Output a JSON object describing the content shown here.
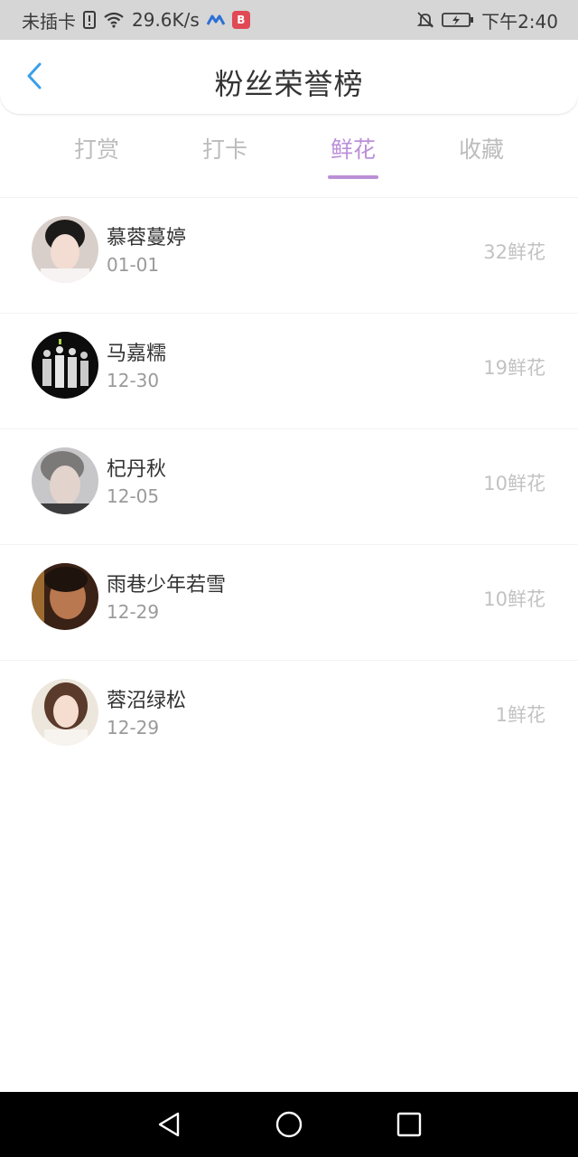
{
  "status_bar": {
    "carrier": "未插卡",
    "speed": "29.6K/s",
    "time": "下午2:40",
    "icons": [
      "sim-alert-icon",
      "wifi-icon",
      "app-notification-icon",
      "app-badge-icon",
      "bell-muted-icon",
      "battery-charging-icon"
    ]
  },
  "header": {
    "title": "粉丝荣誉榜",
    "back_icon": "chevron-left-icon"
  },
  "tabs": [
    {
      "label": "打赏",
      "active": false
    },
    {
      "label": "打卡",
      "active": false
    },
    {
      "label": "鲜花",
      "active": true
    },
    {
      "label": "收藏",
      "active": false
    }
  ],
  "list": [
    {
      "name": "慕蓉蔓婷",
      "date": "01-01",
      "count": "32鲜花"
    },
    {
      "name": "马嘉糯",
      "date": "12-30",
      "count": "19鲜花"
    },
    {
      "name": "杞丹秋",
      "date": "12-05",
      "count": "10鲜花"
    },
    {
      "name": "雨巷少年若雪",
      "date": "12-29",
      "count": "10鲜花"
    },
    {
      "name": "蓉沼绿松",
      "date": "12-29",
      "count": "1鲜花"
    }
  ],
  "nav_bar": {
    "icons": [
      "back-triangle-icon",
      "home-circle-icon",
      "recents-square-icon"
    ]
  },
  "colors": {
    "accent": "#bb8fd8",
    "back_arrow": "#3aa0e8",
    "status_bar_bg": "#d6d6d6",
    "muted_text": "#9a9a9a"
  }
}
